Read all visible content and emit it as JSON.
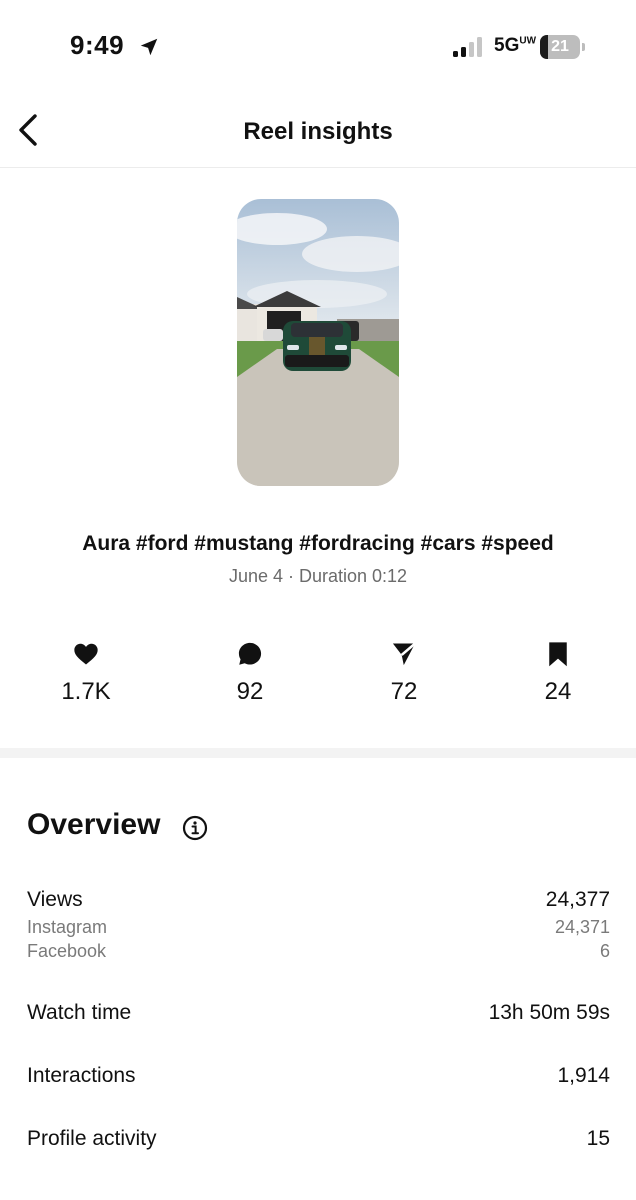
{
  "status_bar": {
    "time": "9:49",
    "network": "5G",
    "network_sup": "UW",
    "battery_level": "21",
    "battery_fraction": 0.21
  },
  "header": {
    "title": "Reel insights",
    "back_icon": "chevron-left-icon"
  },
  "reel": {
    "thumbnail_alt": "thumbnail",
    "caption": "Aura #ford #mustang #fordracing #cars #speed",
    "meta": "June 4 · Duration 0:12"
  },
  "stats": [
    {
      "icon": "heart-icon",
      "value": "1.7K"
    },
    {
      "icon": "comment-icon",
      "value": "92"
    },
    {
      "icon": "share-icon",
      "value": "72"
    },
    {
      "icon": "bookmark-icon",
      "value": "24"
    }
  ],
  "overview": {
    "title": "Overview",
    "info_icon": "info-icon",
    "views": {
      "label": "Views",
      "value": "24,377",
      "breakdown": [
        {
          "label": "Instagram",
          "value": "24,371"
        },
        {
          "label": "Facebook",
          "value": "6"
        }
      ]
    },
    "watch_time": {
      "label": "Watch time",
      "value": "13h 50m 59s"
    },
    "interactions": {
      "label": "Interactions",
      "value": "1,914"
    },
    "profile_activity": {
      "label": "Profile activity",
      "value": "15"
    }
  },
  "colors": {
    "text": "#111111",
    "secondary": "#6b6b6b",
    "divider": "#f3f3f3",
    "car": "#1f4a38"
  }
}
